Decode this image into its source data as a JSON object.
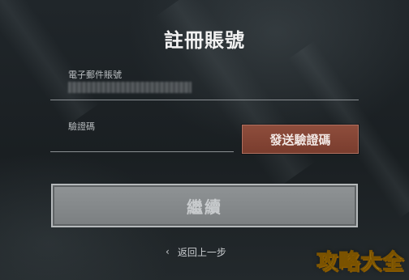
{
  "form": {
    "title": "註冊賬號",
    "email_label": "電子郵件賬號",
    "email_value": "",
    "code_label": "驗證碼",
    "code_value": "",
    "send_code_label": "發送驗證碼",
    "continue_label": "繼續",
    "back_label": "返回上一步",
    "back_icon": "chevron-left-icon"
  },
  "watermark": {
    "text": "攻略大全"
  },
  "colors": {
    "background": "#1c2023",
    "send_button": "#7f4232",
    "continue_button_disabled": "#85898b",
    "watermark": "#ffd84a"
  }
}
